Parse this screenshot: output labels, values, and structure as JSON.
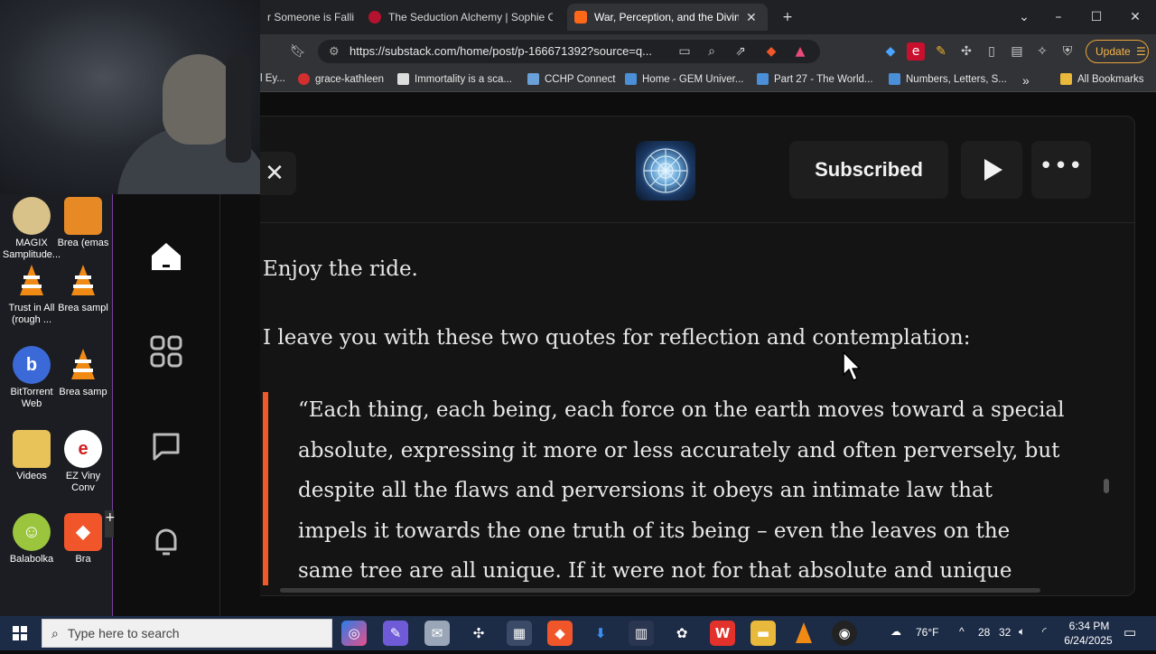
{
  "desktop": {
    "icons": [
      {
        "label": "MAGIX Samplitude...",
        "icon": "magix-icon"
      },
      {
        "label": "Brea (emas",
        "icon": "audio-file-icon"
      },
      {
        "label": "Trust in All (rough ...",
        "icon": "vlc-icon"
      },
      {
        "label": "Brea sampl",
        "icon": "vlc-icon"
      },
      {
        "label": "BitTorrent Web",
        "icon": "bittorrent-icon"
      },
      {
        "label": "Brea samp",
        "icon": "vlc-icon"
      },
      {
        "label": "Videos",
        "icon": "folder-icon"
      },
      {
        "label": "EZ Viny Conv",
        "icon": "ez-vinyl-icon"
      },
      {
        "label": "Balabolka",
        "icon": "balabolka-icon"
      },
      {
        "label": "Bra",
        "icon": "brave-icon"
      }
    ]
  },
  "browser": {
    "tabs": [
      {
        "title": "r Someone is Fallin",
        "active": false
      },
      {
        "title": "The Seduction Alchemy | Sophie Cart",
        "active": false
      },
      {
        "title": "War, Perception, and the Divine (",
        "active": true
      }
    ],
    "new_tab_symbol": "+",
    "url": "https://substack.com/home/post/p-166671392?source=q...",
    "update_label": "Update",
    "bookmarks": [
      {
        "label": "l Ey..."
      },
      {
        "label": "grace-kathleen"
      },
      {
        "label": "Immortality is a sca..."
      },
      {
        "label": "CCHP Connect"
      },
      {
        "label": "Home - GEM Univer..."
      },
      {
        "label": "Part 27 - The World..."
      },
      {
        "label": "Numbers, Letters, S..."
      }
    ],
    "more_bookmarks": "»",
    "all_bookmarks": "All Bookmarks"
  },
  "reader": {
    "subscribed_label": "Subscribed",
    "para1": "Enjoy the ride.",
    "para2": "I leave you with these two quotes for reflection and contemplation:",
    "quote_lines": [
      "“Each thing, each being, each force on the earth moves toward a special",
      "absolute, expressing it more or less accurately and often perversely, but",
      "despite all the flaws and perversions it obeys an intimate law that",
      "impels it towards the one truth of its being – even the leaves on the",
      "same tree are all unique. If it were not for that absolute and unique"
    ]
  },
  "taskbar": {
    "search_placeholder": "Type here to search",
    "weather": "76°F",
    "tray_num1": "28",
    "tray_num2": "32",
    "time": "6:34 PM",
    "date": "6/24/2025"
  },
  "colors": {
    "accent_orange": "#f05a28",
    "taskbar": "#1c2b46",
    "reader_bg": "#141414"
  }
}
